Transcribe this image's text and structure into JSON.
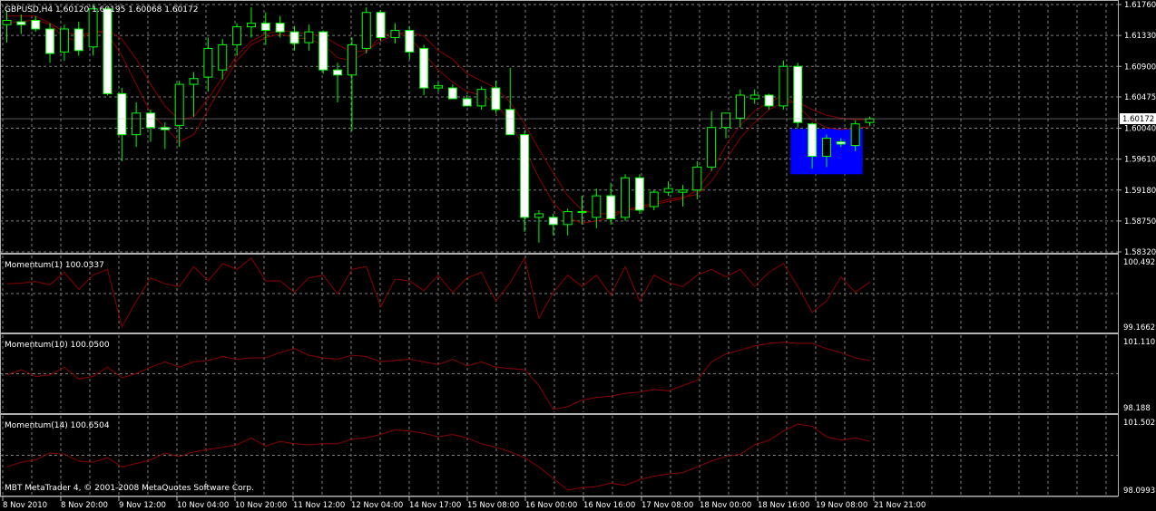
{
  "chart_data": {
    "type": "candlestick",
    "symbol_header": "GBPUSD,H4  1.60120 1.60195 1.60068 1.60172",
    "current_price_label": "1.60172",
    "price_axis": {
      "ylim": [
        1.5832,
        1.6176
      ],
      "ticks": [
        "1.61760",
        "1.61330",
        "1.60900",
        "1.60475",
        "1.60040",
        "1.59610",
        "1.59180",
        "1.58750",
        "1.58320"
      ]
    },
    "time_axis_labels": [
      "8 Nov 2010",
      "8 Nov 20:00",
      "9 Nov 12:00",
      "10 Nov 04:00",
      "10 Nov 20:00",
      "11 Nov 12:00",
      "12 Nov 04:00",
      "14 Nov 17:00",
      "15 Nov 08:00",
      "16 Nov 00:00",
      "16 Nov 16:00",
      "17 Nov 08:00",
      "18 Nov 00:00",
      "18 Nov 16:00",
      "19 Nov 08:00",
      "21 Nov 21:00"
    ],
    "candles": [
      {
        "o": 1.6148,
        "h": 1.6168,
        "l": 1.6123,
        "c": 1.6154
      },
      {
        "o": 1.6152,
        "h": 1.6162,
        "l": 1.6135,
        "c": 1.6148
      },
      {
        "o": 1.6154,
        "h": 1.616,
        "l": 1.6138,
        "c": 1.6142
      },
      {
        "o": 1.6142,
        "h": 1.615,
        "l": 1.6095,
        "c": 1.6108
      },
      {
        "o": 1.611,
        "h": 1.6148,
        "l": 1.6098,
        "c": 1.6142
      },
      {
        "o": 1.6142,
        "h": 1.6152,
        "l": 1.6105,
        "c": 1.6112
      },
      {
        "o": 1.6117,
        "h": 1.6176,
        "l": 1.6105,
        "c": 1.617
      },
      {
        "o": 1.617,
        "h": 1.6172,
        "l": 1.605,
        "c": 1.6052
      },
      {
        "o": 1.6052,
        "h": 1.606,
        "l": 1.5958,
        "c": 1.5995
      },
      {
        "o": 1.5995,
        "h": 1.604,
        "l": 1.5978,
        "c": 1.6025
      },
      {
        "o": 1.6025,
        "h": 1.603,
        "l": 1.5985,
        "c": 1.6005
      },
      {
        "o": 1.6005,
        "h": 1.6012,
        "l": 1.5975,
        "c": 1.6002
      },
      {
        "o": 1.6008,
        "h": 1.607,
        "l": 1.5978,
        "c": 1.6065
      },
      {
        "o": 1.6065,
        "h": 1.6082,
        "l": 1.602,
        "c": 1.6073
      },
      {
        "o": 1.6075,
        "h": 1.613,
        "l": 1.6055,
        "c": 1.6115
      },
      {
        "o": 1.6085,
        "h": 1.6128,
        "l": 1.6072,
        "c": 1.612
      },
      {
        "o": 1.612,
        "h": 1.615,
        "l": 1.6105,
        "c": 1.6145
      },
      {
        "o": 1.6145,
        "h": 1.6172,
        "l": 1.613,
        "c": 1.615
      },
      {
        "o": 1.615,
        "h": 1.6165,
        "l": 1.612,
        "c": 1.614
      },
      {
        "o": 1.615,
        "h": 1.616,
        "l": 1.613,
        "c": 1.6138
      },
      {
        "o": 1.6138,
        "h": 1.6146,
        "l": 1.6112,
        "c": 1.6122
      },
      {
        "o": 1.6123,
        "h": 1.6148,
        "l": 1.6112,
        "c": 1.6138
      },
      {
        "o": 1.6138,
        "h": 1.614,
        "l": 1.608,
        "c": 1.6085
      },
      {
        "o": 1.6085,
        "h": 1.6095,
        "l": 1.604,
        "c": 1.6078
      },
      {
        "o": 1.6078,
        "h": 1.613,
        "l": 1.6,
        "c": 1.612
      },
      {
        "o": 1.6115,
        "h": 1.6172,
        "l": 1.6108,
        "c": 1.6165
      },
      {
        "o": 1.6165,
        "h": 1.6168,
        "l": 1.6125,
        "c": 1.613
      },
      {
        "o": 1.613,
        "h": 1.615,
        "l": 1.6122,
        "c": 1.614
      },
      {
        "o": 1.614,
        "h": 1.6146,
        "l": 1.61,
        "c": 1.611
      },
      {
        "o": 1.6115,
        "h": 1.612,
        "l": 1.605,
        "c": 1.606
      },
      {
        "o": 1.606,
        "h": 1.6068,
        "l": 1.6055,
        "c": 1.6063
      },
      {
        "o": 1.606,
        "h": 1.6065,
        "l": 1.6045,
        "c": 1.6045
      },
      {
        "o": 1.6045,
        "h": 1.605,
        "l": 1.6035,
        "c": 1.6035
      },
      {
        "o": 1.6035,
        "h": 1.6062,
        "l": 1.603,
        "c": 1.6058
      },
      {
        "o": 1.606,
        "h": 1.607,
        "l": 1.6025,
        "c": 1.603
      },
      {
        "o": 1.603,
        "h": 1.6088,
        "l": 1.5995,
        "c": 1.5995
      },
      {
        "o": 1.5995,
        "h": 1.6,
        "l": 1.586,
        "c": 1.588
      },
      {
        "o": 1.588,
        "h": 1.589,
        "l": 1.5845,
        "c": 1.5885
      },
      {
        "o": 1.588,
        "h": 1.5885,
        "l": 1.5855,
        "c": 1.587
      },
      {
        "o": 1.587,
        "h": 1.5892,
        "l": 1.5855,
        "c": 1.5888
      },
      {
        "o": 1.5888,
        "h": 1.591,
        "l": 1.587,
        "c": 1.5888
      },
      {
        "o": 1.588,
        "h": 1.592,
        "l": 1.5865,
        "c": 1.591
      },
      {
        "o": 1.591,
        "h": 1.5928,
        "l": 1.587,
        "c": 1.5878
      },
      {
        "o": 1.588,
        "h": 1.594,
        "l": 1.5875,
        "c": 1.5935
      },
      {
        "o": 1.5935,
        "h": 1.594,
        "l": 1.5885,
        "c": 1.589
      },
      {
        "o": 1.5895,
        "h": 1.5918,
        "l": 1.589,
        "c": 1.5915
      },
      {
        "o": 1.5915,
        "h": 1.593,
        "l": 1.591,
        "c": 1.592
      },
      {
        "o": 1.5915,
        "h": 1.5925,
        "l": 1.5895,
        "c": 1.5918
      },
      {
        "o": 1.5918,
        "h": 1.5958,
        "l": 1.5905,
        "c": 1.595
      },
      {
        "o": 1.595,
        "h": 1.6028,
        "l": 1.5945,
        "c": 1.6005
      },
      {
        "o": 1.6005,
        "h": 1.6025,
        "l": 1.599,
        "c": 1.6025
      },
      {
        "o": 1.6018,
        "h": 1.6058,
        "l": 1.6005,
        "c": 1.605
      },
      {
        "o": 1.6045,
        "h": 1.6058,
        "l": 1.6038,
        "c": 1.605
      },
      {
        "o": 1.605,
        "h": 1.6052,
        "l": 1.603,
        "c": 1.6035
      },
      {
        "o": 1.6035,
        "h": 1.6098,
        "l": 1.603,
        "c": 1.609
      },
      {
        "o": 1.609,
        "h": 1.6095,
        "l": 1.6005,
        "c": 1.6012
      },
      {
        "o": 1.601,
        "h": 1.6012,
        "l": 1.5948,
        "c": 1.5965
      },
      {
        "o": 1.5965,
        "h": 1.5995,
        "l": 1.595,
        "c": 1.599
      },
      {
        "o": 1.5985,
        "h": 1.599,
        "l": 1.5978,
        "c": 1.5982
      },
      {
        "o": 1.598,
        "h": 1.6015,
        "l": 1.5972,
        "c": 1.601
      },
      {
        "o": 1.6012,
        "h": 1.602,
        "l": 1.6007,
        "c": 1.6017
      }
    ],
    "moving_averages": [
      {
        "name": "",
        "color": "#8b0000",
        "values": [
          1.616,
          1.616,
          1.616,
          1.615,
          1.6138,
          1.6133,
          1.6138,
          1.614,
          1.6128,
          1.61,
          1.6065,
          1.6035,
          1.6015,
          1.602,
          1.6045,
          1.6075,
          1.6105,
          1.6125,
          1.6135,
          1.614,
          1.6138,
          1.6135,
          1.6132,
          1.612,
          1.611,
          1.6112,
          1.6125,
          1.6135,
          1.6138,
          1.6132,
          1.6112,
          1.61,
          1.608,
          1.607,
          1.606,
          1.604,
          1.601,
          1.5975,
          1.5942,
          1.591,
          1.589,
          1.5885,
          1.5885,
          1.589,
          1.5895,
          1.59,
          1.5905,
          1.5908,
          1.5912,
          1.593,
          1.596,
          1.599,
          1.6012,
          1.603,
          1.604,
          1.604,
          1.603,
          1.6022,
          1.6018,
          1.6016,
          1.6016
        ]
      },
      {
        "name": "",
        "color": "#8b0000",
        "values": [
          1.615,
          1.6152,
          1.6155,
          1.6148,
          1.613,
          1.6125,
          1.614,
          1.6135,
          1.6105,
          1.6065,
          1.6025,
          1.6005,
          1.5985,
          1.5995,
          1.603,
          1.6065,
          1.6098,
          1.612,
          1.613,
          1.6135,
          1.613,
          1.6128,
          1.612,
          1.6102,
          1.6098,
          1.611,
          1.6132,
          1.6138,
          1.613,
          1.6108,
          1.6085,
          1.6068,
          1.6055,
          1.605,
          1.604,
          1.6012,
          1.5975,
          1.5935,
          1.59,
          1.588,
          1.5872,
          1.5875,
          1.588,
          1.589,
          1.5892,
          1.5898,
          1.5902,
          1.5906,
          1.5918,
          1.5945,
          1.598,
          1.6008,
          1.6028,
          1.604,
          1.605,
          1.6035,
          1.6015,
          1.6005,
          1.6002,
          1.6004,
          1.6006
        ]
      }
    ],
    "highlight": {
      "color": "#0000ff",
      "from_index": 55,
      "to_index": 59,
      "top": 1.6003,
      "bottom": 1.594
    },
    "indicators": [
      {
        "label": "Momentum(1) 100.0337",
        "ymax_label": "100.492",
        "ymin_label": "99.1662",
        "ylim": [
          99.1662,
          100.492
        ],
        "values": [
          100.0,
          100.01,
          100.04,
          99.98,
          100.2,
          99.9,
          100.15,
          100.25,
          99.25,
          99.7,
          100.1,
          100.0,
          99.95,
          100.3,
          100.05,
          100.35,
          100.25,
          100.45,
          100.05,
          100.05,
          99.85,
          100.1,
          100.15,
          99.82,
          100.25,
          100.3,
          99.6,
          100.08,
          100.05,
          99.88,
          100.15,
          99.85,
          100.1,
          100.2,
          99.7,
          100.02,
          100.45,
          99.4,
          99.85,
          100.15,
          99.95,
          100.15,
          99.8,
          100.3,
          99.7,
          100.15,
          100.02,
          99.95,
          100.15,
          100.25,
          100.12,
          100.25,
          99.95,
          100.2,
          100.35,
          99.95,
          99.5,
          99.7,
          100.12,
          99.85,
          100.03
        ]
      },
      {
        "label": "Momentum(10) 100.0500",
        "ymax_label": "101.110",
        "ymin_label": "98.188",
        "ylim": [
          98.188,
          101.11
        ],
        "values": [
          99.6,
          99.8,
          99.55,
          99.6,
          99.9,
          99.45,
          99.55,
          99.9,
          99.5,
          99.65,
          99.9,
          100.1,
          99.9,
          100.1,
          100.15,
          100.3,
          100.2,
          100.25,
          100.25,
          100.45,
          100.6,
          100.35,
          100.25,
          100.2,
          100.35,
          100.3,
          100.1,
          100.15,
          100.2,
          100.1,
          100.0,
          100.2,
          99.95,
          100.1,
          99.9,
          99.85,
          99.8,
          99.2,
          98.3,
          98.4,
          98.65,
          98.75,
          98.8,
          98.9,
          98.95,
          99.05,
          99.0,
          99.2,
          99.4,
          100.1,
          100.4,
          100.55,
          100.7,
          100.8,
          100.85,
          100.8,
          100.8,
          100.6,
          100.45,
          100.25,
          100.15
        ]
      },
      {
        "label": "Momentum(14) 100.6504",
        "ymax_label": "101.502",
        "ymin_label": "98.0993",
        "ylim": [
          98.0993,
          101.502
        ],
        "values": [
          99.3,
          99.5,
          99.6,
          99.9,
          99.85,
          99.55,
          99.5,
          99.7,
          99.3,
          99.45,
          99.6,
          99.9,
          99.75,
          99.95,
          100.05,
          100.15,
          100.25,
          100.55,
          100.2,
          100.4,
          100.3,
          100.25,
          100.3,
          100.3,
          100.5,
          100.55,
          100.7,
          100.9,
          100.85,
          100.75,
          100.6,
          100.7,
          100.55,
          100.3,
          100.15,
          99.95,
          99.7,
          99.3,
          98.8,
          98.3,
          98.4,
          98.45,
          98.6,
          98.5,
          98.75,
          98.9,
          99.0,
          99.05,
          99.3,
          99.55,
          99.75,
          99.85,
          100.25,
          100.45,
          100.85,
          101.15,
          101.05,
          100.6,
          100.45,
          100.55,
          100.4
        ]
      }
    ],
    "copyright": "MBT MetaTrader 4, © 2001-2008 MetaQuotes Software Corp.",
    "grid": true
  },
  "colors": {
    "background": "#000000",
    "grid": "#808080",
    "bull_fill": "#000000",
    "bear_fill": "#ffffff",
    "wick": "#00ff00",
    "indicator_line": "#8b0000",
    "panel_border": "#b0b0b0",
    "price_tag_bg": "#ffffff"
  }
}
